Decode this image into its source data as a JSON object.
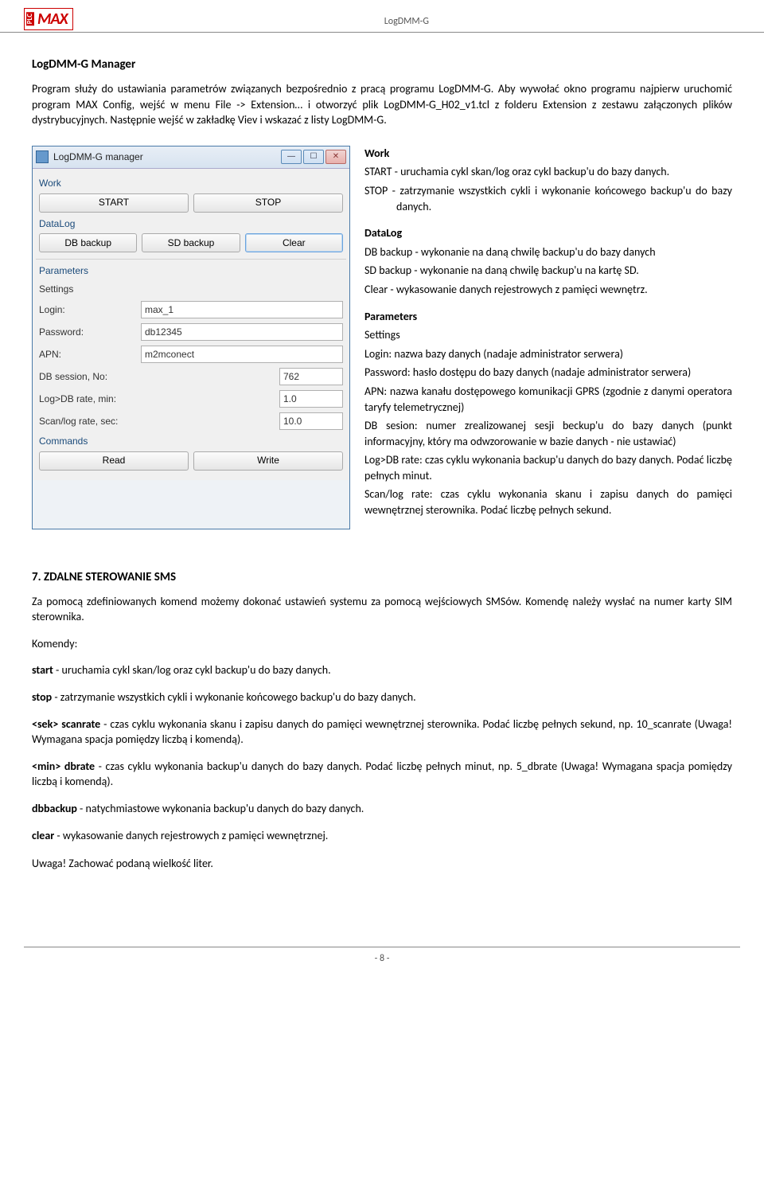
{
  "header": {
    "title": "LogDMM-G",
    "logo_side": "PLC",
    "logo_main": "MAX"
  },
  "intro": {
    "title": "LogDMM-G Manager",
    "paragraph": "Program służy do ustawiania parametrów związanych bezpośrednio z pracą programu LogDMM-G. Aby wywołać okno programu najpierw uruchomić program MAX Config, wejść w menu File -> Extension… i otworzyć plik LogDMM-G_H02_v1.tcl z folderu Extension z zestawu załączonych plików dystrybucyjnych. Następnie wejść w zakładkę Viev i wskazać z listy LogDMM-G."
  },
  "window": {
    "title": "LogDMM-G manager",
    "sections": {
      "work": "Work",
      "datalog": "DataLog",
      "parameters": "Parameters",
      "settings": "Settings",
      "commands": "Commands"
    },
    "buttons": {
      "start": "START",
      "stop": "STOP",
      "dbbackup": "DB backup",
      "sdbackup": "SD backup",
      "clear": "Clear",
      "read": "Read",
      "write": "Write"
    },
    "labels": {
      "login": "Login:",
      "password": "Password:",
      "apn": "APN:",
      "dbsession": "DB session, No:",
      "logdb": "Log>DB rate, min:",
      "scanlog": "Scan/log rate, sec:"
    },
    "values": {
      "login": "max_1",
      "password": "db12345",
      "apn": "m2mconect",
      "dbsession": "762",
      "logdb": "1.0",
      "scanlog": "10.0"
    }
  },
  "descriptions": {
    "work_hd": "Work",
    "work_start": "START - uruchamia cykl skan/log oraz cykl backup'u do bazy danych.",
    "work_stop": "STOP - zatrzymanie wszystkich cykli i wykonanie końcowego backup'u do bazy danych.",
    "datalog_hd": "DataLog",
    "datalog_db": "DB backup - wykonanie na daną chwilę backup'u do bazy danych",
    "datalog_sd": "SD backup - wykonanie na daną chwilę backup'u na kartę SD.",
    "datalog_clear": "Clear - wykasowanie danych rejestrowych z pamięci wewnętrz.",
    "param_hd": "Parameters",
    "param_settings": "Settings",
    "param_login": "Login: nazwa bazy danych (nadaje administrator serwera)",
    "param_pwd": "Password: hasło dostępu do bazy danych (nadaje administrator serwera)",
    "param_apn": "APN: nazwa kanału dostępowego komunikacji GPRS (zgodnie z danymi operatora taryfy telemetrycznej)",
    "param_dbs": "DB sesion: numer zrealizowanej sesji beckup'u do bazy danych (punkt informacyjny, który ma odwzorowanie w bazie danych - nie ustawiać)",
    "param_logdb": "Log>DB rate: czas cyklu wykonania backup'u danych do bazy danych. Podać liczbę pełnych minut.",
    "param_scan": "Scan/log rate: czas cyklu wykonania skanu i zapisu danych do pamięci wewnętrznej sterownika. Podać liczbę pełnych sekund."
  },
  "sms": {
    "title": "7. ZDALNE STEROWANIE SMS",
    "intro": "Za pomocą zdefiniowanych komend możemy dokonać ustawień systemu za pomocą wejściowych SMSów. Komendę należy wysłać na numer karty SIM sterownika.",
    "komendy_hd": "Komendy:",
    "start_b": "start",
    "start_t": " - uruchamia cykl skan/log oraz cykl backup'u do bazy danych.",
    "stop_b": "stop",
    "stop_t": " - zatrzymanie wszystkich cykli i wykonanie końcowego backup'u do bazy danych.",
    "scan_b": "<sek>  scanrate",
    "scan_t": " - czas cyklu wykonania skanu i zapisu danych do pamięci wewnętrznej sterownika. Podać liczbę pełnych sekund, np. 10_scanrate (Uwaga! Wymagana spacja pomiędzy liczbą i komendą).",
    "dbr_b": "<min> dbrate",
    "dbr_t": " - czas cyklu wykonania backup'u danych do bazy danych. Podać liczbę pełnych minut, np. 5_dbrate (Uwaga! Wymagana spacja pomiędzy liczbą i komendą).",
    "dbb_b": "dbbackup",
    "dbb_t": " - natychmiastowe wykonania backup'u danych do bazy danych.",
    "clr_b": "clear",
    "clr_t": " - wykasowanie danych rejestrowych z pamięci wewnętrznej.",
    "warn": "Uwaga! Zachować podaną wielkość liter."
  },
  "footer": {
    "page": "- 8 -"
  }
}
